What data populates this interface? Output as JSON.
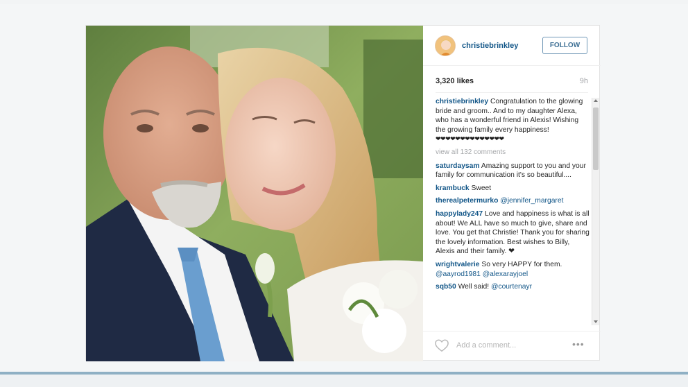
{
  "post": {
    "username": "christiebrinkley",
    "follow_label": "FOLLOW",
    "likes": "3,320 likes",
    "time": "9h",
    "caption": {
      "user": "christiebrinkley",
      "text": "Congratulation to the glowing bride and groom.. And to my daughter Alexa, who has a wonderful friend in Alexis! Wishing the growing family every happiness!",
      "hearts": "❤❤❤❤❤❤❤❤❤❤❤❤❤❤"
    },
    "view_all": "view all 132 comments",
    "comments": [
      {
        "user": "saturdaysam",
        "text": "Amazing support to you and your family for communication it's so beautiful...."
      },
      {
        "user": "krambuck",
        "text": "Sweet"
      },
      {
        "user": "therealpetermurko",
        "mention": "@jennifer_margaret"
      },
      {
        "user": "happylady247",
        "text": "Love and happiness is what is all about! We ALL have so much to give, share and love. You get that Christie! Thank you for sharing the lovely information. Best wishes to Billy, Alexis and their family. ❤"
      },
      {
        "user": "wrightvalerie",
        "text": "So very HAPPY for them.",
        "mention": "@aayrod1981 @alexarayjoel"
      },
      {
        "user": "sqb50",
        "text": "Well said!",
        "mention": "@courtenayr"
      }
    ],
    "comment_placeholder": "Add a comment...",
    "more_glyph": "•••"
  },
  "icons": {
    "heart": "heart-outline-icon",
    "more": "more-options-icon",
    "avatar": "avatar"
  },
  "colors": {
    "username_blue": "#125688",
    "follow_border": "#6f97b6",
    "muted_gray": "#a5a7aa"
  }
}
